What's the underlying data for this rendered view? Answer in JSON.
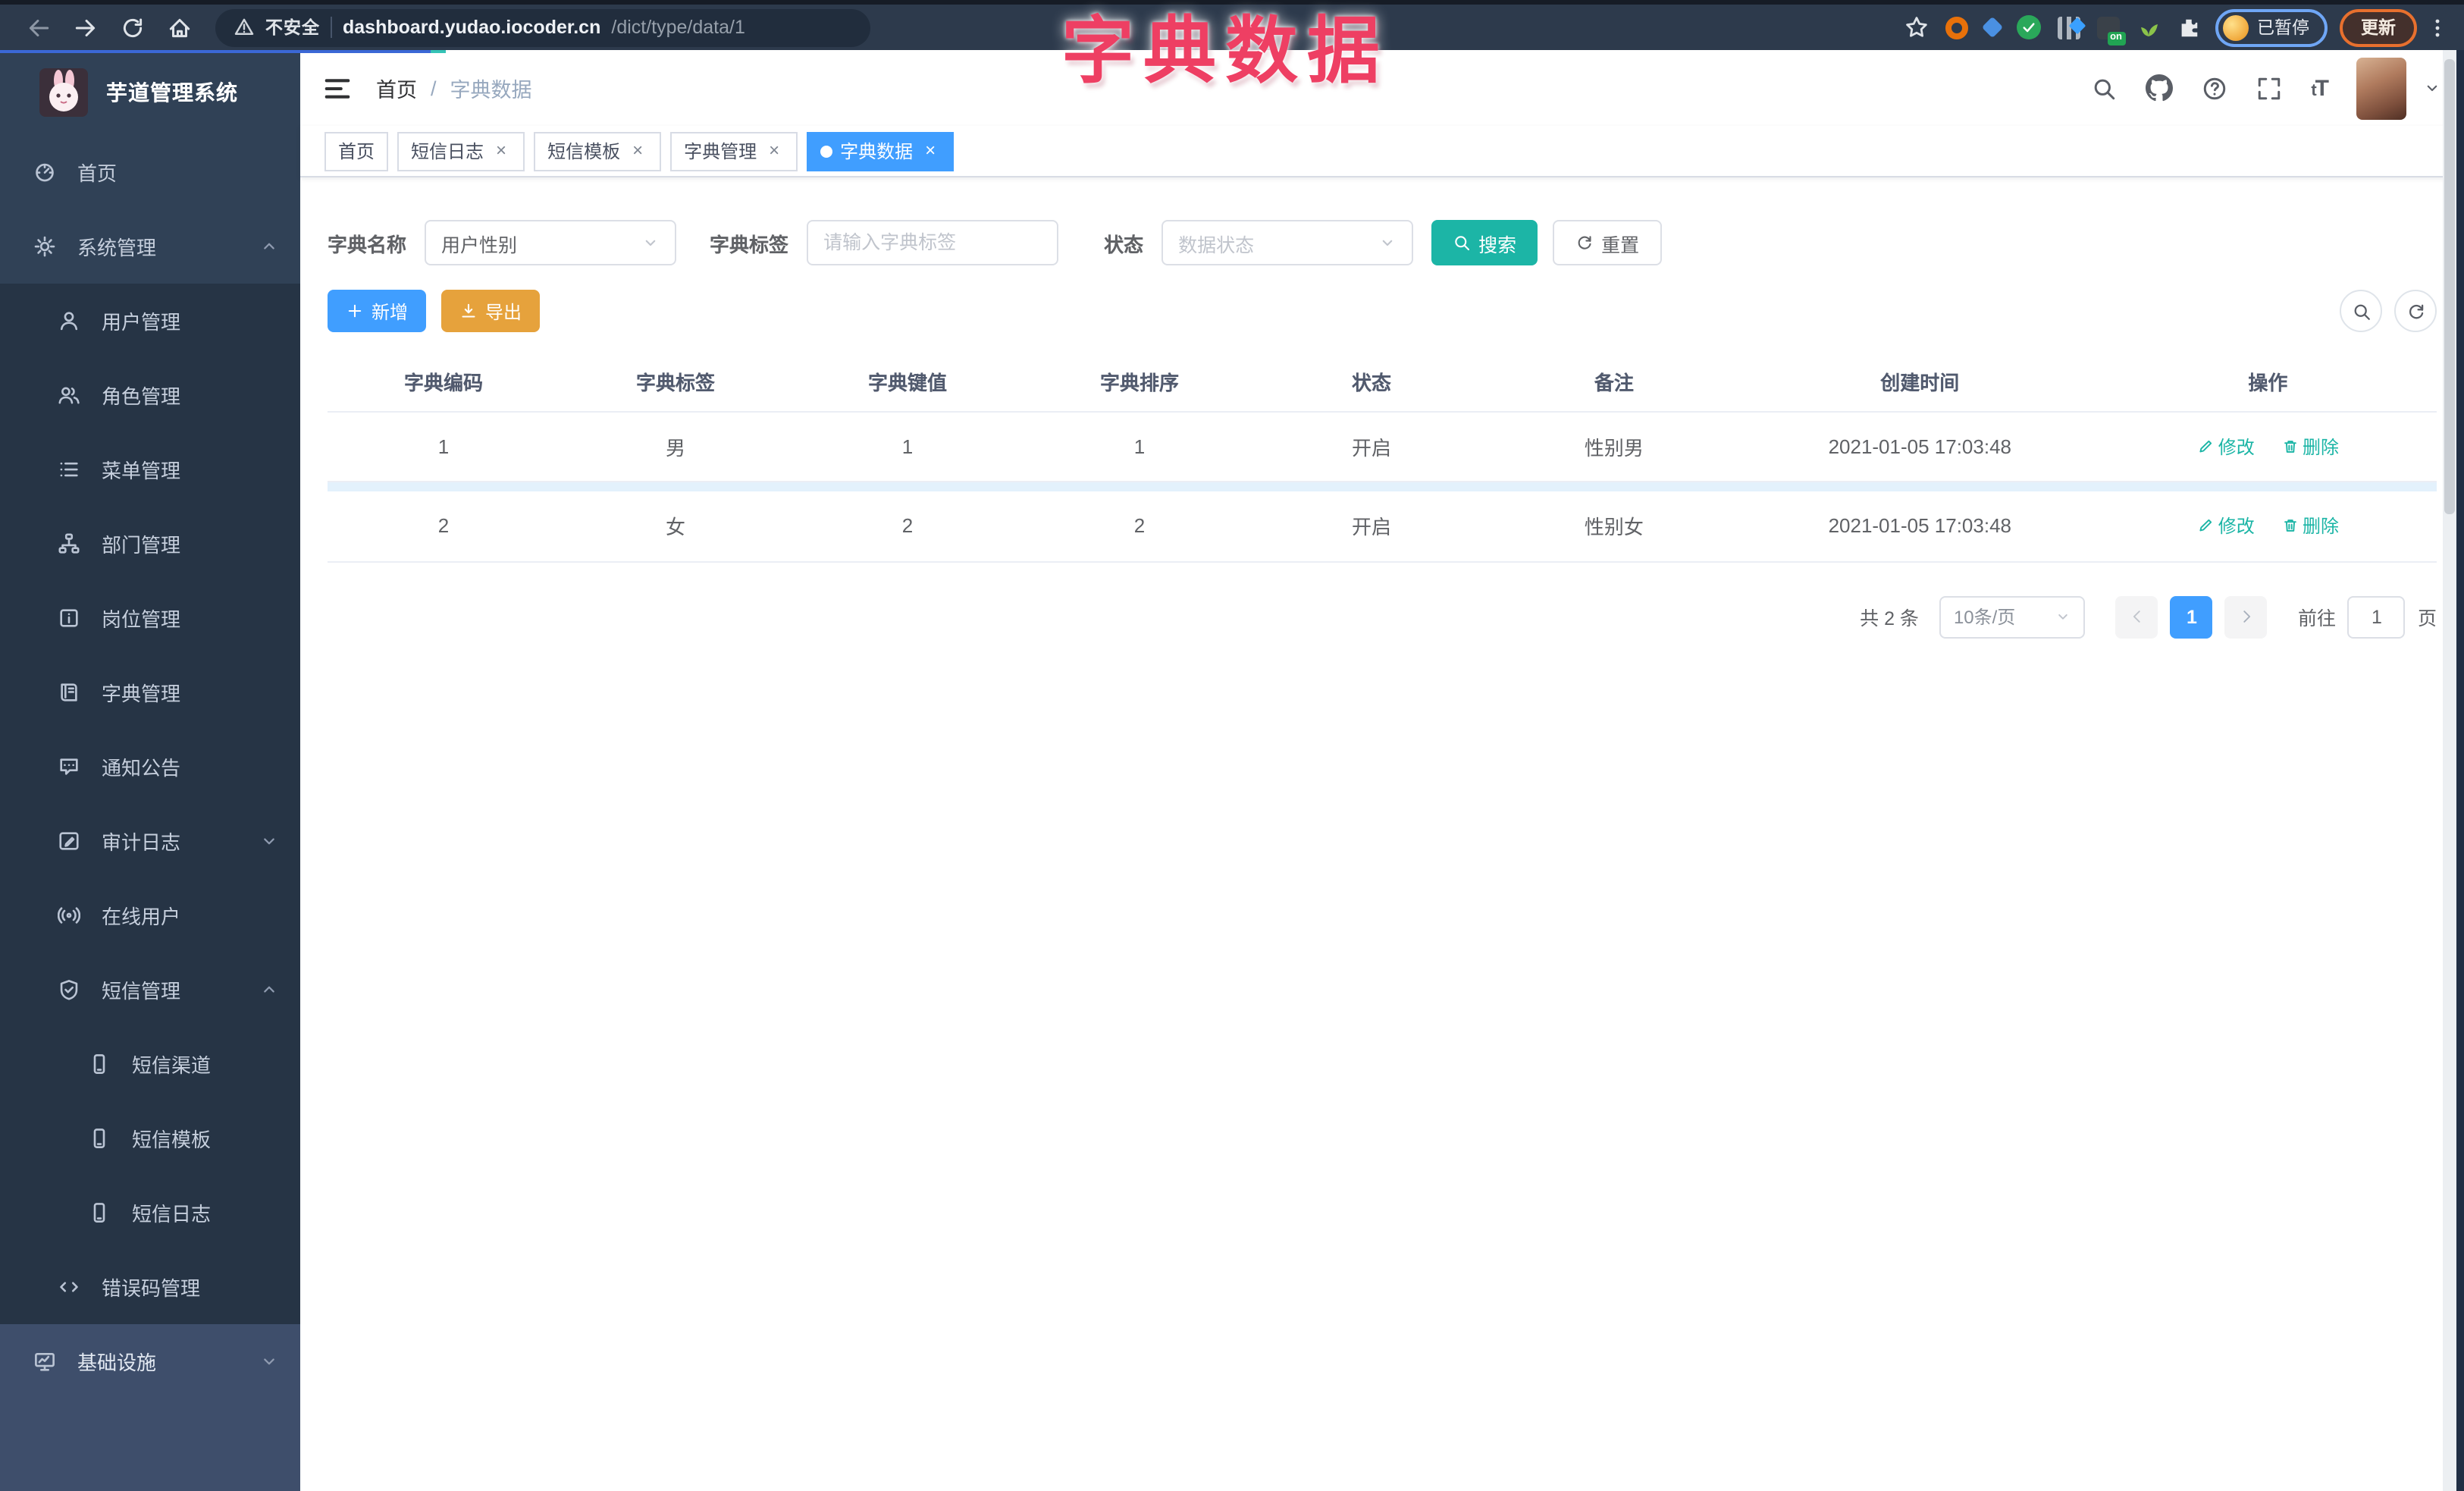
{
  "colors": {
    "primary": "#409eff",
    "teal": "#1cb5a6",
    "warning": "#e6a23c",
    "overlay_pink": "#ee3f63",
    "sidebar_bg": "#304156",
    "chrome_bg": "#2d3a4c"
  },
  "overlay_title": "字典数据",
  "browser": {
    "security_label": "不安全",
    "url_host": "dashboard.yudao.iocoder.cn",
    "url_path": "/dict/type/data/1",
    "paused_badge": "已暂停",
    "update_button": "更新",
    "extension_on_badge": "on",
    "nav_icons": [
      "back-icon",
      "forward-icon",
      "reload-icon",
      "home-icon"
    ],
    "ext_icons": [
      "bookmark-star-icon",
      "orange-ring-extension-icon",
      "blue-drop-extension-icon",
      "green-check-extension-icon",
      "bars-extension-icon",
      "on-extension-icon",
      "sprout-extension-icon",
      "puzzle-extensions-icon",
      "kebab-menu-icon"
    ]
  },
  "sidebar": {
    "logo_title": "芋道管理系统",
    "items": [
      {
        "label": "首页",
        "level": 1,
        "icon": "dashboard-icon"
      },
      {
        "label": "系统管理",
        "level": 1,
        "icon": "gear-icon",
        "chevron": "up"
      },
      {
        "label": "用户管理",
        "level": 2,
        "icon": "user-icon"
      },
      {
        "label": "角色管理",
        "level": 2,
        "icon": "users-icon"
      },
      {
        "label": "菜单管理",
        "level": 2,
        "icon": "menu-list-icon"
      },
      {
        "label": "部门管理",
        "level": 2,
        "icon": "org-tree-icon"
      },
      {
        "label": "岗位管理",
        "level": 2,
        "icon": "badge-icon"
      },
      {
        "label": "字典管理",
        "level": 2,
        "icon": "book-icon"
      },
      {
        "label": "通知公告",
        "level": 2,
        "icon": "message-icon"
      },
      {
        "label": "审计日志",
        "level": 2,
        "icon": "edit-log-icon",
        "chevron": "down"
      },
      {
        "label": "在线用户",
        "level": 2,
        "icon": "online-icon"
      },
      {
        "label": "短信管理",
        "level": 2,
        "icon": "shield-icon",
        "chevron": "up"
      },
      {
        "label": "短信渠道",
        "level": 3,
        "icon": "phone-icon"
      },
      {
        "label": "短信模板",
        "level": 3,
        "icon": "phone-icon"
      },
      {
        "label": "短信日志",
        "level": 3,
        "icon": "phone-icon"
      },
      {
        "label": "错误码管理",
        "level": 2,
        "icon": "code-icon"
      },
      {
        "label": "基础设施",
        "level": 1,
        "icon": "monitor-icon",
        "chevron": "down",
        "highlighted": true
      }
    ]
  },
  "header": {
    "breadcrumb": {
      "home": "首页",
      "separator": "/",
      "current": "字典数据"
    },
    "right_icons": [
      "search-icon",
      "github-icon",
      "help-icon",
      "fullscreen-icon",
      "font-size-icon",
      "user-avatar",
      "caret-down-icon"
    ],
    "font_size_icon_text": "tT"
  },
  "tabs": {
    "items": [
      {
        "label": "首页",
        "closable": false,
        "active": false
      },
      {
        "label": "短信日志",
        "closable": true,
        "active": false
      },
      {
        "label": "短信模板",
        "closable": true,
        "active": false
      },
      {
        "label": "字典管理",
        "closable": true,
        "active": false
      },
      {
        "label": "字典数据",
        "closable": true,
        "active": true
      }
    ],
    "close_glyph": "×"
  },
  "search": {
    "name_label": "字典名称",
    "name_value": "用户性别",
    "tag_label": "字典标签",
    "tag_placeholder": "请输入字典标签",
    "status_label": "状态",
    "status_placeholder": "数据状态",
    "search_button": "搜索",
    "reset_button": "重置"
  },
  "toolbar": {
    "add_button": "新增",
    "export_button": "导出",
    "right_icons": [
      "search-toggle-icon",
      "refresh-icon"
    ]
  },
  "table": {
    "columns": [
      "字典编码",
      "字典标签",
      "字典键值",
      "字典排序",
      "状态",
      "备注",
      "创建时间",
      "操作"
    ],
    "rows": [
      {
        "code": "1",
        "label": "男",
        "value": "1",
        "sort": "1",
        "status": "开启",
        "remark": "性别男",
        "created": "2021-01-05 17:03:48"
      },
      {
        "code": "2",
        "label": "女",
        "value": "2",
        "sort": "2",
        "status": "开启",
        "remark": "性别女",
        "created": "2021-01-05 17:03:48"
      }
    ],
    "edit_label": "修改",
    "delete_label": "删除"
  },
  "pagination": {
    "total": "共 2 条",
    "page_size": "10条/页",
    "current_page": "1",
    "goto_label": "前往",
    "goto_value": "1",
    "page_unit": "页"
  }
}
